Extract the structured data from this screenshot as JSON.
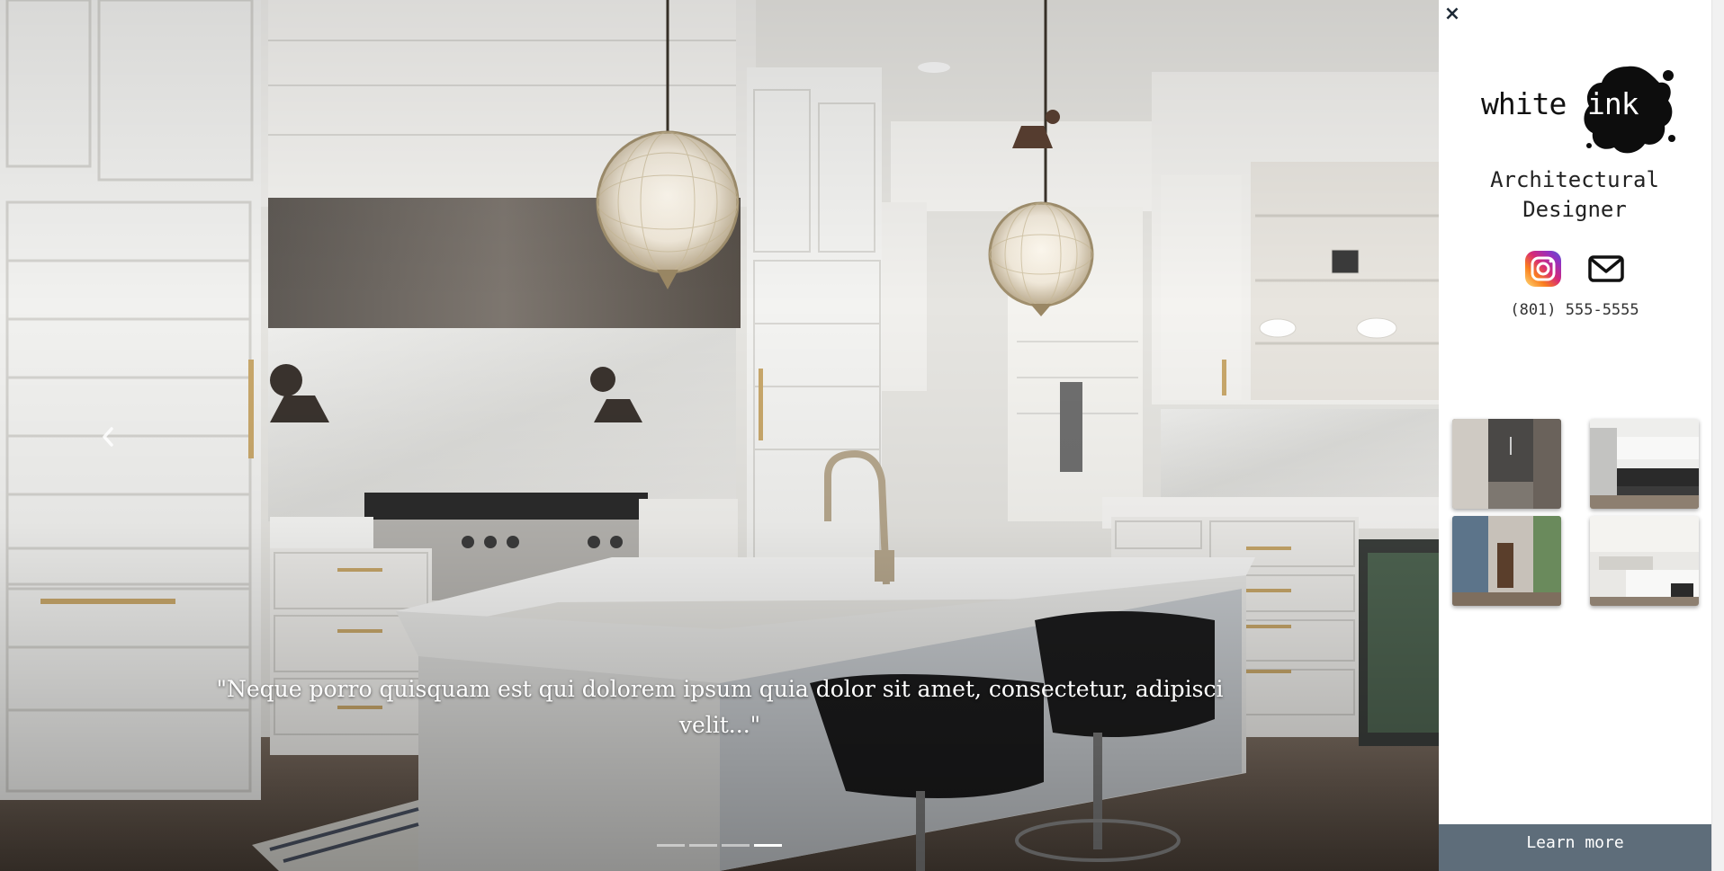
{
  "hero": {
    "caption": "\"Neque porro quisquam est qui dolorem ipsum quia dolor sit amet, consectetur, adipisci velit...\"",
    "prev_icon": "chevron-left-icon",
    "slide_count": 4,
    "active_slide": 4
  },
  "panel": {
    "close_label": "×",
    "logo": {
      "word1": "white",
      "word2": "ink"
    },
    "subtitle": "Architectural\nDesigner",
    "social": [
      {
        "name": "instagram-icon"
      },
      {
        "name": "envelope-icon"
      }
    ],
    "phone": "(801) 555-5555",
    "thumbnails": [
      {
        "name": "thumbnail-shower"
      },
      {
        "name": "thumbnail-kitchen-dark"
      },
      {
        "name": "thumbnail-hallway"
      },
      {
        "name": "thumbnail-kitchen-white"
      }
    ],
    "learn_more": "Learn more"
  },
  "colors": {
    "panel_button": "#5e6d7a",
    "close_icon": "#1e2a36",
    "instagram_gradient": [
      "#feda75",
      "#fa7e1e",
      "#d62976",
      "#962fbf",
      "#4f5bd5"
    ]
  }
}
